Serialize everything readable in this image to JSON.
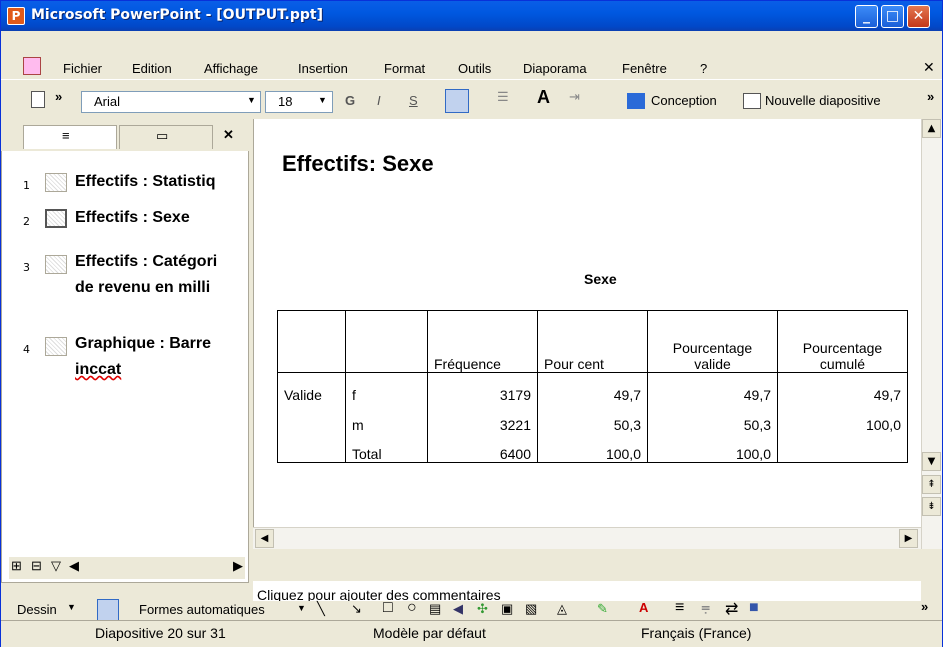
{
  "window": {
    "title": "Microsoft PowerPoint - [OUTPUT.ppt]"
  },
  "menu": [
    "Fichier",
    "Edition",
    "Affichage",
    "Insertion",
    "Format",
    "Outils",
    "Diaporama",
    "Fenêtre",
    "?"
  ],
  "toolbar": {
    "font": "Arial",
    "size": "18",
    "bold": "G",
    "italic": "I",
    "shadow": "S",
    "design_label": "Conception",
    "new_slide_label": "Nouvelle diapositive"
  },
  "slides": [
    {
      "num": "1",
      "title": "Effectifs : Statistiq"
    },
    {
      "num": "2",
      "title": "Effectifs : Sexe"
    },
    {
      "num": "3",
      "title": "Effectifs : Catégori",
      "line2": "de revenu en milli"
    },
    {
      "num": "4",
      "title": "Graphique : Barre",
      "line2": "inccat"
    }
  ],
  "slide": {
    "title": "Effectifs: Sexe",
    "table_caption": "Sexe",
    "headers": [
      "",
      "",
      "Fréquence",
      "Pour cent",
      "Pourcentage valide",
      "Pourcentage cumulé"
    ],
    "rows": [
      [
        "Valide",
        "f",
        "3179",
        "49,7",
        "49,7",
        "49,7"
      ],
      [
        "",
        "m",
        "3221",
        "50,3",
        "50,3",
        "100,0"
      ],
      [
        "",
        "Total",
        "6400",
        "100,0",
        "100,0",
        ""
      ]
    ]
  },
  "notes_placeholder": "Cliquez pour ajouter des commentaires",
  "drawbar": {
    "draw": "Dessin",
    "autoshapes": "Formes automatiques"
  },
  "status": {
    "slide": "Diapositive 20 sur 31",
    "template": "Modèle par défaut",
    "language": "Français (France)"
  }
}
